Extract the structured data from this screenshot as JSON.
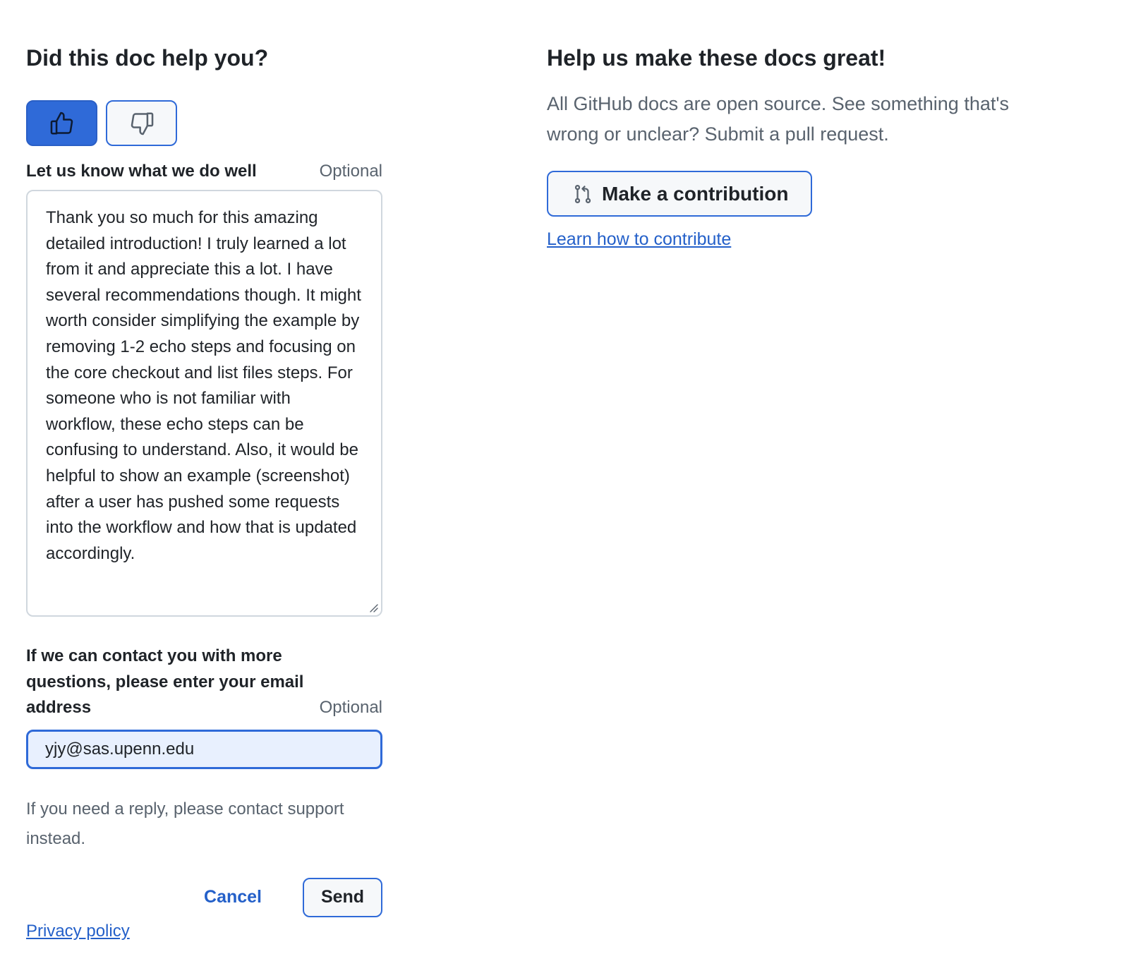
{
  "feedback": {
    "title": "Did this doc help you?",
    "vote_up_icon": "thumbs-up-icon",
    "vote_down_icon": "thumbs-down-icon",
    "vote_selected": "up",
    "comment_label": "Let us know what we do well",
    "comment_optional": "Optional",
    "comment_value": "Thank you so much for this amazing detailed introduction! I truly learned a lot from it and appreciate this a lot. I have several recommendations though. It might worth consider simplifying the example by removing 1-2 echo steps and focusing on the core checkout and list files steps. For someone who is not familiar with workflow, these echo steps can be confusing to understand. Also, it would be helpful to show an example (screenshot) after a user has pushed some requests into the workflow and how that is updated accordingly.",
    "email_label": "If we can contact you with more questions, please enter your email address",
    "email_optional": "Optional",
    "email_value": "yjy@sas.upenn.edu",
    "reply_note": "If you need a reply, please contact support instead.",
    "cancel_label": "Cancel",
    "send_label": "Send",
    "privacy_label": "Privacy policy"
  },
  "contribute": {
    "title": "Help us make these docs great!",
    "text": "All GitHub docs are open source. See something that's wrong or unclear? Submit a pull request.",
    "button_label": "Make a contribution",
    "button_icon": "git-pull-request-icon",
    "learn_link": "Learn how to contribute"
  },
  "colors": {
    "accent": "#2f6ad8",
    "link": "#2460c9",
    "muted_text": "#59636e",
    "input_focus_bg": "#e8f0fe"
  }
}
